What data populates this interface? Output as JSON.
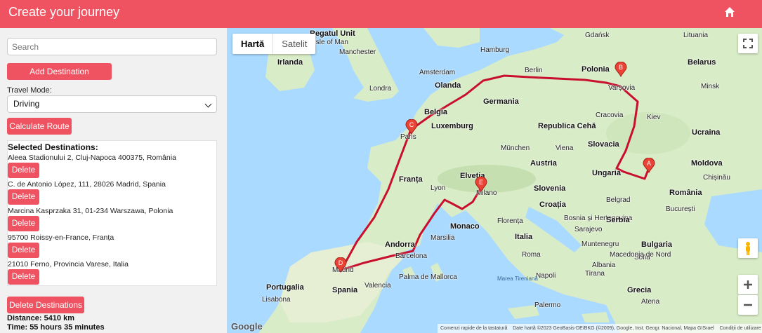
{
  "header": {
    "title": "Create your journey"
  },
  "sidebar": {
    "search_placeholder": "Search",
    "add_label": "Add Destination",
    "travel_mode_label": "Travel Mode:",
    "travel_mode_value": "Driving",
    "calc_label": "Calculate Route",
    "selected_title": "Selected Destinations:",
    "destinations": [
      {
        "address": "Aleea Stadionului 2, Cluj-Napoca 400375, România",
        "delete": "Delete"
      },
      {
        "address": "C. de Antonio López, 111, 28026 Madrid, Spania",
        "delete": "Delete"
      },
      {
        "address": "Marcina Kasprzaka 31, 01-234 Warszawa, Polonia",
        "delete": "Delete"
      },
      {
        "address": "95700 Roissy-en-France, Franța",
        "delete": "Delete"
      },
      {
        "address": "21010 Ferno, Provincia Varese, Italia",
        "delete": "Delete"
      }
    ],
    "delete_all_label": "Delete Destinations",
    "distance": "Distance: 5410 km",
    "time": "Time: 55 hours 35 minutes"
  },
  "map": {
    "type_map": "Hartă",
    "type_sat": "Satelit",
    "markers": [
      "A",
      "B",
      "C",
      "D",
      "E"
    ],
    "labels": {
      "regatul_unit": "Regatul Unit",
      "isle_of_man": "Isle of Man",
      "manchester": "Manchester",
      "irlanda": "Irlanda",
      "londra": "Londra",
      "olanda": "Olanda",
      "amsterdam": "Amsterdam",
      "hamburg": "Hamburg",
      "berlin": "Berlin",
      "gdansk": "Gdańsk",
      "polonia": "Polonia",
      "varsovia": "Varșovia",
      "belarus": "Belarus",
      "minsk": "Minsk",
      "lituania": "Lituania",
      "belgia": "Belgia",
      "luxemburg": "Luxemburg",
      "germania": "Germania",
      "cracovia": "Cracovia",
      "ucraina": "Ucraina",
      "kiev": "Kiev",
      "paris": "Paris",
      "republica_ceha": "Republica Cehă",
      "slovacia": "Slovacia",
      "munchen": "München",
      "viena": "Viena",
      "franta": "Franța",
      "austria": "Austria",
      "ungaria": "Ungaria",
      "moldova": "Moldova",
      "chisinau": "Chișinău",
      "elvetia": "Elveția",
      "lyon": "Lyon",
      "milano": "Milano",
      "slovenia": "Slovenia",
      "croatia": "Croația",
      "romania": "România",
      "bucuresti": "București",
      "belgrad": "Belgrad",
      "bosnia": "Bosnia și Herțegovina",
      "serbia": "Serbia",
      "monaco": "Monaco",
      "florenta": "Florența",
      "sarajevo": "Sarajevo",
      "bulgaria": "Bulgaria",
      "marsilia": "Marsilia",
      "andorra": "Andorra",
      "italia": "Italia",
      "muntenegru": "Muntenegru",
      "sofia": "Sofia",
      "roma": "Roma",
      "barcelona": "Barcelona",
      "macedonia": "Macedonia de Nord",
      "madrid": "Madrid",
      "albania": "Albania",
      "tirana": "Tirana",
      "portugalia": "Portugalia",
      "lisabona": "Lisabona",
      "valencia": "Valencia",
      "palma": "Palma de Mallorca",
      "napoli": "Napoli",
      "spania": "Spania",
      "grecia": "Grecia",
      "palermo": "Palermo",
      "atena": "Atena",
      "tirenian": "Marea Tireniană",
      "google": "Google",
      "footer_shortcuts": "Comenzi rapide de la tastatură",
      "footer_data": "Date hartă ©2023 GeoBasis-DE/BKG (©2009), Google, Inst. Geogr. Nacional, Mapa GISrael",
      "footer_terms": "Condiții de utilizare"
    }
  },
  "colors": {
    "accent": "#ef5361",
    "route": "#c8102e",
    "water": "#aadaff",
    "land": "#d9ecc8"
  }
}
